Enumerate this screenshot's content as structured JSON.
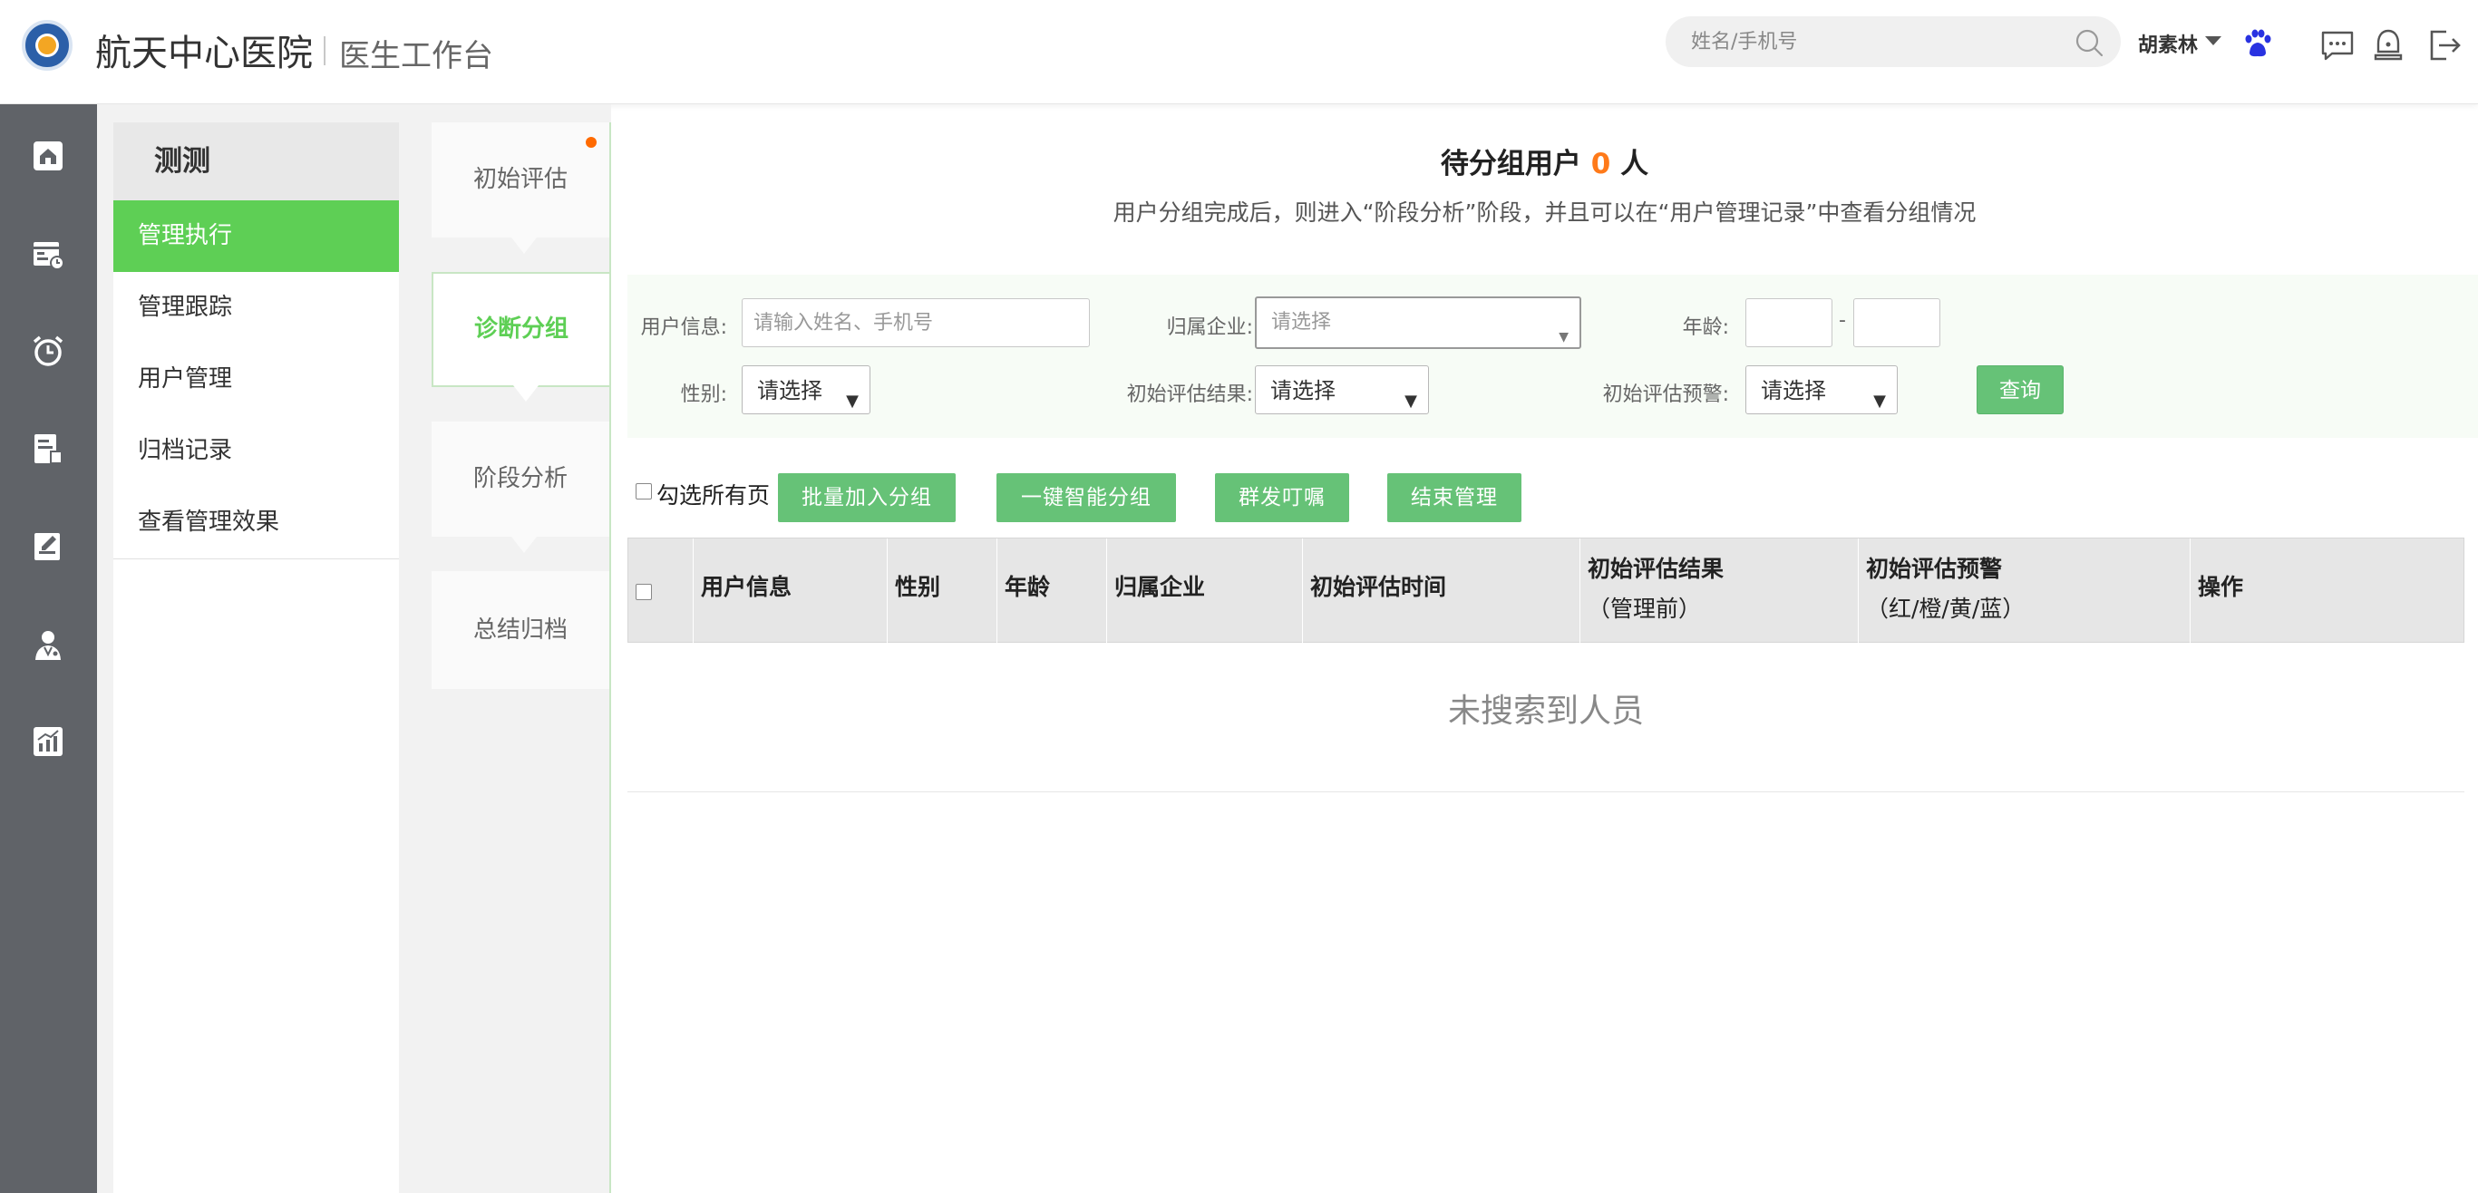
{
  "header": {
    "hospital_name": "航天中心医院",
    "workbench": "医生工作台",
    "search_placeholder": "姓名/手机号",
    "user_name": "胡素林",
    "icons": [
      "search-icon",
      "paw-icon",
      "message-icon",
      "alert-icon",
      "logout-icon"
    ]
  },
  "leftnav": {
    "icons": [
      "home-icon",
      "calendar-icon",
      "alarm-clock-icon",
      "report-icon",
      "edit-note-icon",
      "doctor-icon",
      "chart-icon"
    ]
  },
  "submenu": {
    "title": "测测",
    "items": [
      {
        "label": "管理执行",
        "active": true
      },
      {
        "label": "管理跟踪",
        "active": false
      },
      {
        "label": "用户管理",
        "active": false
      },
      {
        "label": "归档记录",
        "active": false
      },
      {
        "label": "查看管理效果",
        "active": false
      }
    ]
  },
  "steps": [
    {
      "label": "初始评估",
      "active": false,
      "dot": true
    },
    {
      "label": "诊断分组",
      "active": true,
      "dot": false
    },
    {
      "label": "阶段分析",
      "active": false,
      "dot": false
    },
    {
      "label": "总结归档",
      "active": false,
      "dot": false
    }
  ],
  "main": {
    "title_prefix": "待分组用户",
    "count": "0",
    "title_suffix": "人",
    "subtitle": "用户分组完成后，则进入“阶段分析”阶段，并且可以在“用户管理记录”中查看分组情况"
  },
  "filters": {
    "user_info_label": "用户信息:",
    "user_info_placeholder": "请输入姓名、手机号",
    "company_label": "归属企业:",
    "company_value": "请选择",
    "age_label": "年龄:",
    "age_dash": "-",
    "gender_label": "性别:",
    "gender_value": "请选择",
    "result_label": "初始评估结果:",
    "result_value": "请选择",
    "warning_label": "初始评估预警:",
    "warning_value": "请选择",
    "query_button": "查询"
  },
  "toolbar": {
    "select_all_pages": "勾选所有页",
    "batch_add": "批量加入分组",
    "smart_group": "一键智能分组",
    "group_remind": "群发叮嘱",
    "end_manage": "结束管理"
  },
  "table": {
    "columns": [
      {
        "line1": "用户信息",
        "line2": ""
      },
      {
        "line1": "性别",
        "line2": ""
      },
      {
        "line1": "年龄",
        "line2": ""
      },
      {
        "line1": "归属企业",
        "line2": ""
      },
      {
        "line1": "初始评估时间",
        "line2": ""
      },
      {
        "line1": "初始评估结果",
        "line2": "（管理前）"
      },
      {
        "line1": "初始评估预警",
        "line2": "（红/橙/黄/蓝）"
      },
      {
        "line1": "操作",
        "line2": ""
      }
    ],
    "empty_message": "未搜索到人员"
  },
  "colors": {
    "accent_green": "#5ecf55",
    "button_green": "#66c277",
    "count_orange": "#ff7a1a",
    "nav_bg": "#606368"
  }
}
